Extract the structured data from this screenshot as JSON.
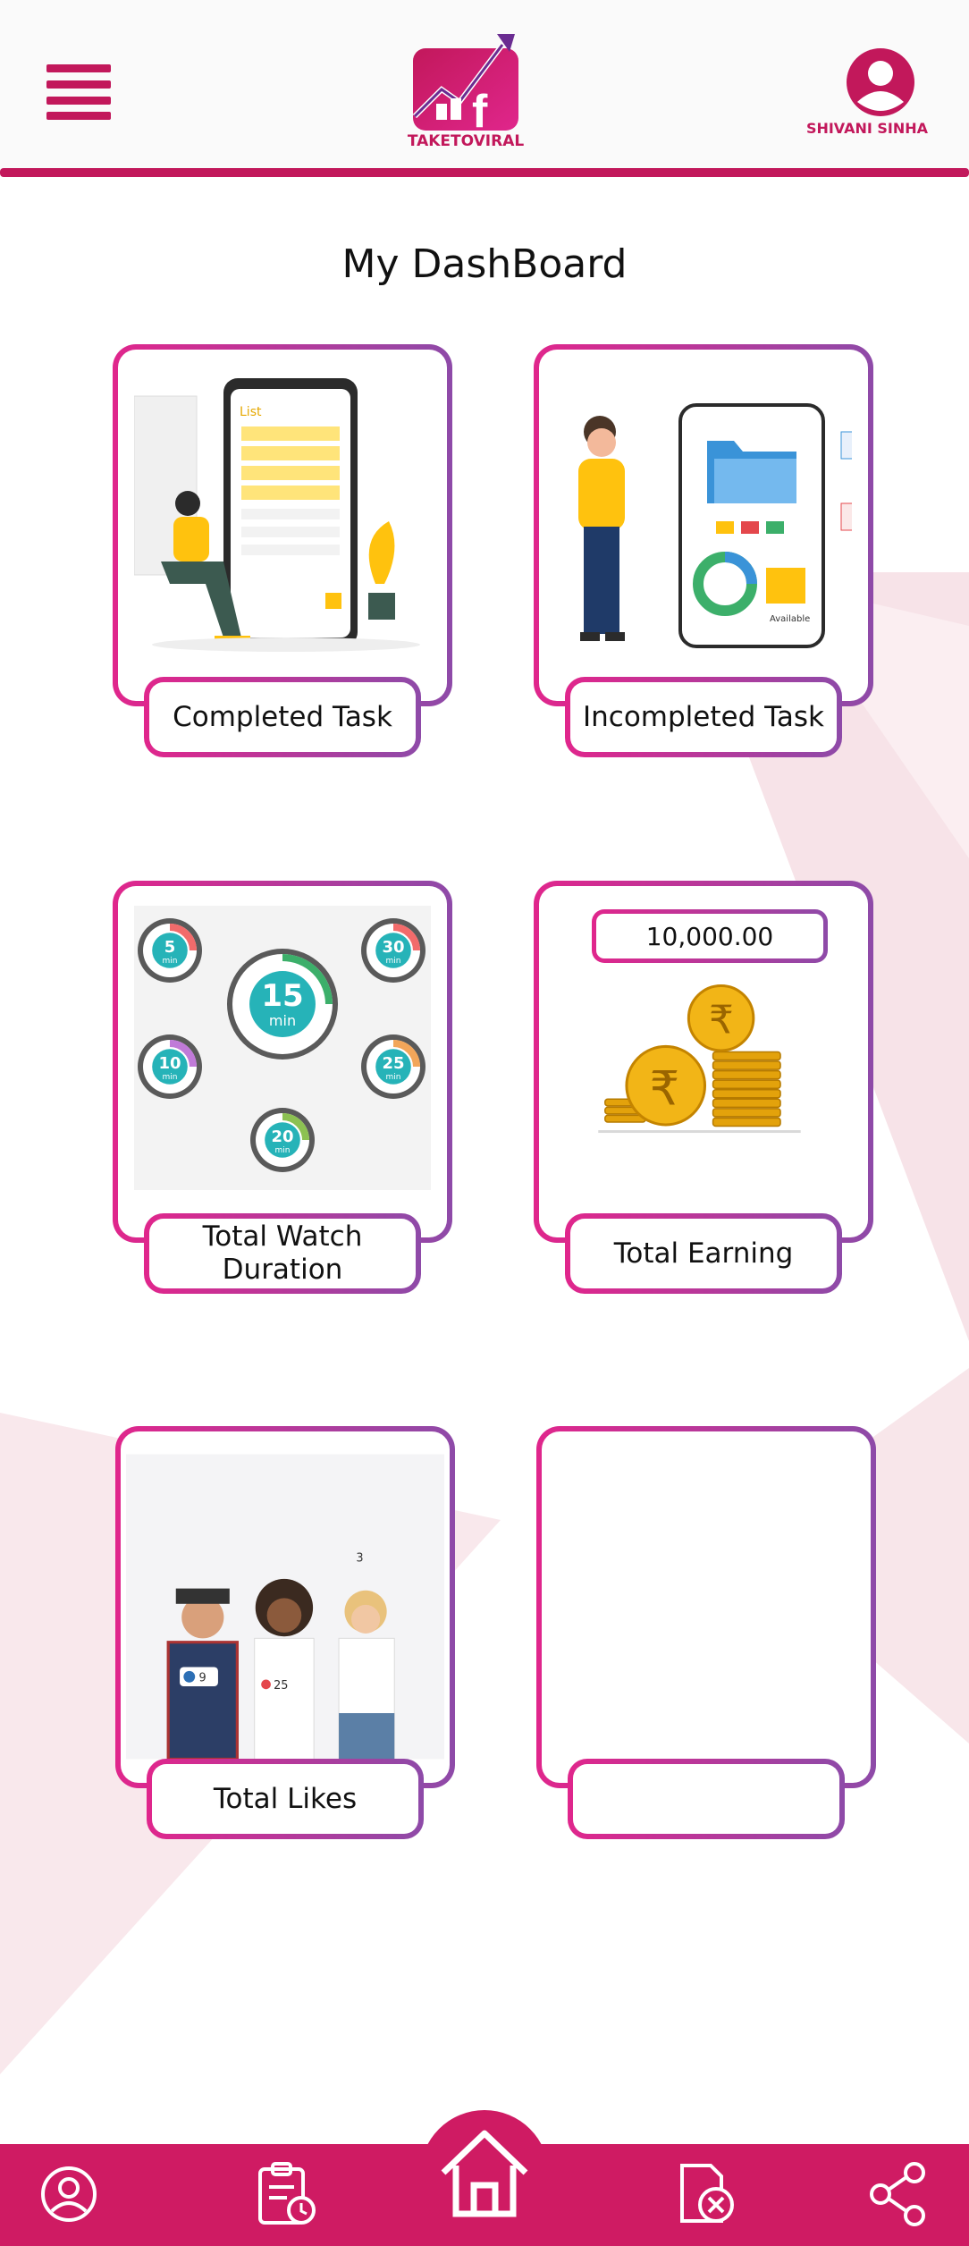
{
  "header": {
    "menu_icon": "hamburger-menu-icon",
    "logo_text": "TAKETOVIRAL",
    "user_name": "SHIVANI SINHA",
    "profile_icon": "user-avatar-icon"
  },
  "page_title": "My DashBoard",
  "cards": [
    {
      "label": "Completed Task",
      "illustration": "task-checklist-illustration"
    },
    {
      "label": "Incompleted Task",
      "illustration": "phone-folder-illustration"
    },
    {
      "label": "Total Watch Duration",
      "illustration": "timers-illustration",
      "timers": [
        "5",
        "15",
        "30",
        "10",
        "25",
        "20"
      ],
      "timer_unit": "min"
    },
    {
      "label": "Total Earning",
      "value": "10,000.00",
      "illustration": "rupee-coins-illustration"
    },
    {
      "label": "Total Likes",
      "illustration": "friends-likes-photo",
      "badges": [
        "3",
        "9",
        "25"
      ]
    },
    {
      "label": "",
      "illustration": ""
    }
  ],
  "illustration_text": {
    "list_title": "List",
    "available": "Available"
  },
  "bottom_nav": [
    {
      "name": "profile",
      "icon": "user-circle-icon"
    },
    {
      "name": "tasks",
      "icon": "clipboard-clock-icon"
    },
    {
      "name": "home",
      "icon": "home-icon"
    },
    {
      "name": "incomplete",
      "icon": "document-cancel-icon"
    },
    {
      "name": "share",
      "icon": "share-icon"
    }
  ],
  "colors": {
    "primary": "#c2185b",
    "nav": "#cf1b63",
    "gradient_start": "#e0268c",
    "gradient_end": "#8e4aa8",
    "background_accent": "#f7e3e8"
  }
}
